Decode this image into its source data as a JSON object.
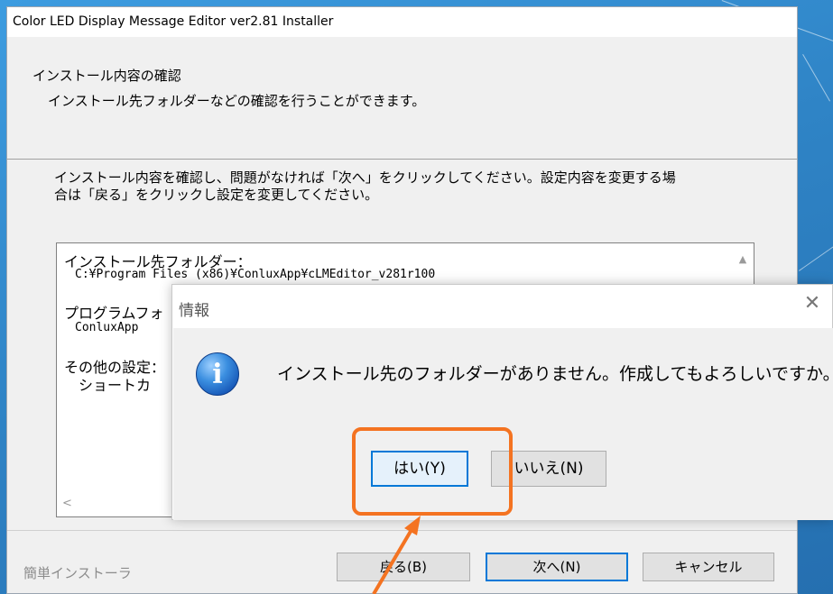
{
  "window": {
    "title": "Color LED Display Message Editor ver2.81 Installer",
    "header_title": "インストール内容の確認",
    "header_subtitle": "インストール先フォルダーなどの確認を行うことができます。",
    "instruction_line1": "インストール内容を確認し、問題がなければ「次へ」をクリックしてください。設定内容を変更する場",
    "instruction_line2": "合は「戻る」をクリックし設定を変更してください。",
    "summary": {
      "folder_label": "インストール先フォルダー：",
      "folder_path": "C:¥Program Files (x86)¥ConluxApp¥cLMEditor_v281r100",
      "program_label": "プログラムフォ",
      "program_value": "ConluxApp",
      "other_label": "その他の設定：",
      "other_value": "ショートカ"
    },
    "footer_label": "簡単インストーラ",
    "back_button": "戻る(B)",
    "next_button": "次へ(N)",
    "cancel_button": "キャンセル"
  },
  "dialog": {
    "title": "情報",
    "message": "インストール先のフォルダーがありません。作成してもよろしいですか。",
    "yes_button": "はい(Y)",
    "no_button": "いいえ(N)"
  },
  "icons": {
    "dialog_icon": "info-icon",
    "close": "close-icon",
    "scroll_up": "scroll-up-arrow-icon",
    "scroll_left": "scroll-left-arrow-icon"
  },
  "colors": {
    "desktop": "#2d88c9",
    "annotation": "#f47321",
    "focus": "#0078d7"
  }
}
